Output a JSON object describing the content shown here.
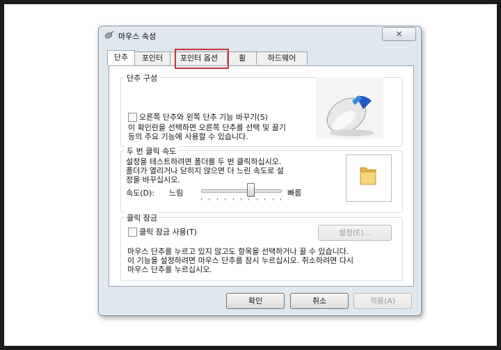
{
  "window": {
    "title": "마우스 속성",
    "close_glyph": "✕"
  },
  "tabs": [
    {
      "label": "단추"
    },
    {
      "label": "포인터"
    },
    {
      "label": "포인터 옵션"
    },
    {
      "label": "휠"
    },
    {
      "label": "하드웨어"
    }
  ],
  "active_tab": "단추",
  "highlight_color": "#c8323c",
  "button_config": {
    "title": "단추 구성",
    "checkbox_label": "오른쪽 단추와 왼쪽 단추 기능 바꾸기(S)",
    "checked": false,
    "description": [
      "이 확인란을 선택하면 오른쪽 단추를 선택 및 끌기",
      "등의 주요 기능에 사용할 수 있습니다."
    ]
  },
  "double_click": {
    "title": "두 번 클릭 속도",
    "description": [
      "설정을 테스트하려면 폴더를 두 번 클릭하십시오.",
      "폴더가 열리거나 닫히지 않으면 더 느린 속도로 설",
      "정을 바꾸십시오."
    ],
    "speed_label": "속도(D):",
    "slow_label": "느림",
    "fast_label": "빠름",
    "speed_fraction": 0.62
  },
  "click_lock": {
    "title": "클릭 잠금",
    "checkbox_label": "클릭 잠금 사용(T)",
    "checked": false,
    "settings_button": "설정(E)...",
    "description": [
      "마우스 단추를 누르고 있지 않고도 항목을 선택하거나 끌 수 있습니다.",
      "이 기능을 설정하려면 마우스 단추를 잠시 누르십시오. 취소하려면 다시",
      "마우스 단추를 누르십시오."
    ]
  },
  "footer": {
    "ok": "확인",
    "cancel": "취소",
    "apply": "적용(A)"
  }
}
